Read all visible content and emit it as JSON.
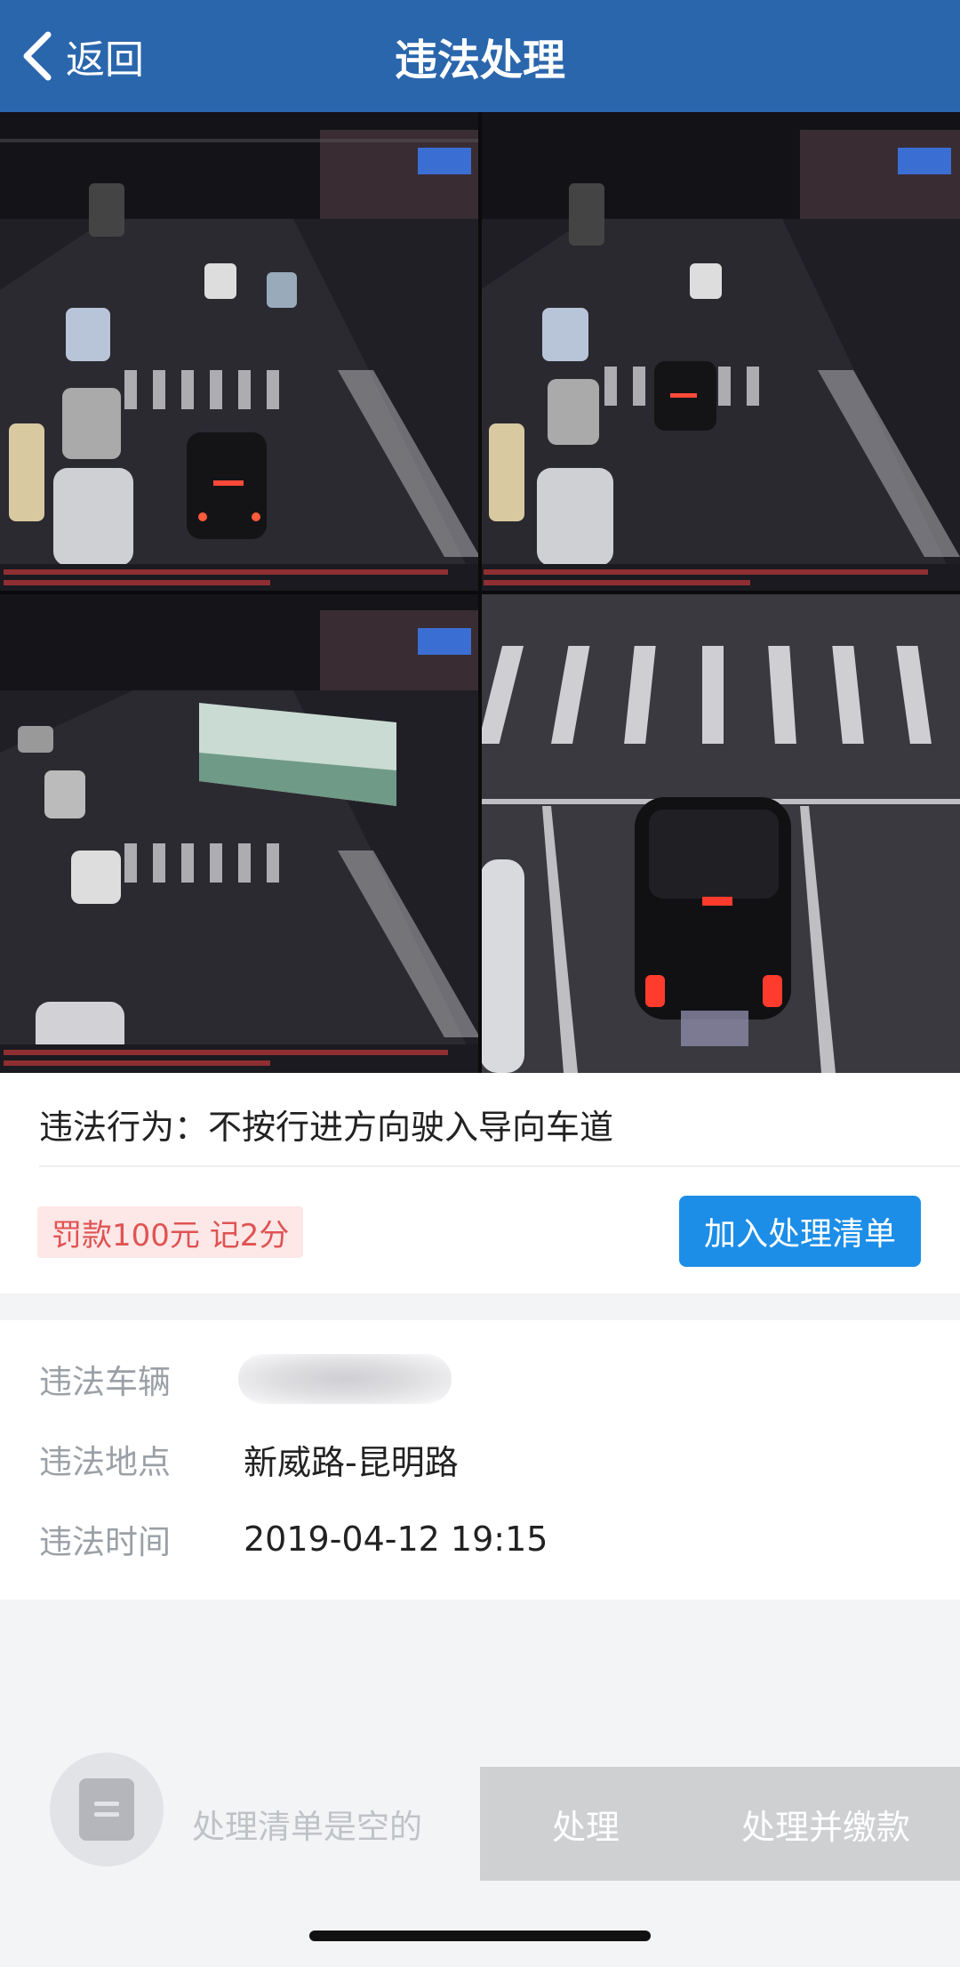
{
  "header": {
    "back_label": "返回",
    "title": "违法处理",
    "color": "#2a66ac"
  },
  "photos": {
    "count": 4
  },
  "violation": {
    "behavior": "违法行为：不按行进方向驶入导向车道",
    "penalty": "罚款100元 记2分",
    "add_button": "加入处理清单"
  },
  "details": {
    "vehicle_label": "违法车辆",
    "location_label": "违法地点",
    "location_value": "新威路-昆明路",
    "time_label": "违法时间",
    "time_value": "2019-04-12 19:15"
  },
  "bottom": {
    "empty_text": "处理清单是空的",
    "process_button": "处理",
    "pay_button": "处理并缴款"
  },
  "colors": {
    "primary_button": "#1c8ee8",
    "penalty_text": "#e05353",
    "penalty_bg": "#fde7e7"
  },
  "icons": {
    "back": "chevron-left-icon",
    "cart": "list-icon"
  }
}
